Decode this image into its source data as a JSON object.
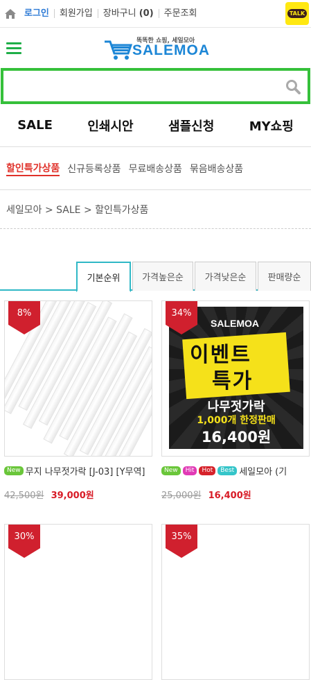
{
  "topbar": {
    "home_icon": "home-icon",
    "links": [
      "로그인",
      "회원가입",
      "장바구니",
      "주문조회"
    ],
    "cart_count": "(0)",
    "talk_label": "TALK"
  },
  "header": {
    "logo_tagline": "똑똑한 쇼핑, 세일모아",
    "logo_text": "SALEMOA"
  },
  "search": {
    "value": "",
    "placeholder": ""
  },
  "main_nav": [
    "SALE",
    "인쇄시안",
    "샘플신청",
    "MY쇼핑"
  ],
  "sub_nav": [
    "할인특가상품",
    "신규등록상품",
    "무료배송상품",
    "묶음배송상품"
  ],
  "breadcrumb": "세일모아 > SALE > 할인특가상품",
  "sort_tabs": [
    "기본순위",
    "가격높은순",
    "가격낮은순",
    "판매량순"
  ],
  "products": [
    {
      "discount": "8%",
      "tags": [
        "New"
      ],
      "name": "무지 나무젓가락 [J-03] [Y무역]",
      "old_price": "42,500원",
      "price": "39,000원"
    },
    {
      "discount": "34%",
      "tags": [
        "New",
        "Hit",
        "Hot",
        "Best"
      ],
      "name": "세일모아 (기",
      "old_price": "25,000원",
      "price": "16,400원",
      "image_text": {
        "brand": "SALEMOA",
        "headline1": "이벤트",
        "headline2": "특가",
        "subtitle": "나무젓가락",
        "limit": "1,000개 한정판매",
        "price": "16,400원"
      }
    },
    {
      "discount": "30%"
    },
    {
      "discount": "35%"
    }
  ],
  "colors": {
    "accent_green": "#35c03a",
    "brand_blue": "#1c86d6",
    "sale_red": "#d81b26",
    "tab_teal": "#2fb8c6"
  }
}
